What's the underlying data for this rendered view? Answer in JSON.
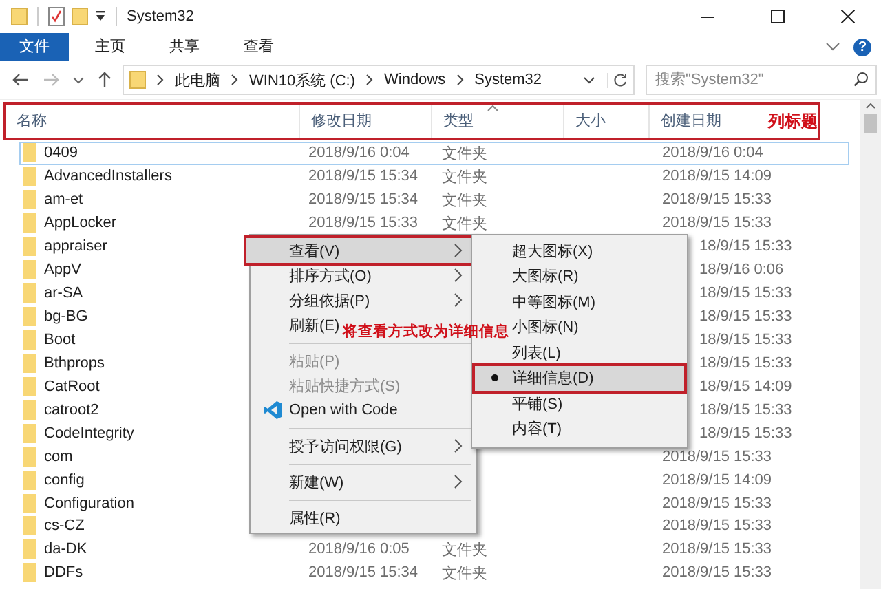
{
  "window": {
    "title": "System32"
  },
  "ribbon": {
    "tabs": [
      {
        "label": "文件",
        "selected": true
      },
      {
        "label": "主页",
        "selected": false
      },
      {
        "label": "共享",
        "selected": false
      },
      {
        "label": "查看",
        "selected": false
      }
    ],
    "help": "?"
  },
  "address": {
    "path": [
      "此电脑",
      "WIN10系统 (C:)",
      "Windows",
      "System32"
    ],
    "search": {
      "placeholder": "搜索\"System32\""
    }
  },
  "header": {
    "outlined": true,
    "annotation": "列标题",
    "columns": [
      {
        "label": "名称",
        "sorted": false
      },
      {
        "label": "修改日期",
        "sorted": false
      },
      {
        "label": "类型",
        "sorted": true
      },
      {
        "label": "大小",
        "sorted": false
      },
      {
        "label": "创建日期",
        "sorted": false
      }
    ]
  },
  "rows": [
    {
      "name": "0409",
      "modified": "2018/9/16 0:04",
      "type": "文件夹",
      "created": "2018/9/16 0:04",
      "covered": false,
      "focused": true
    },
    {
      "name": "AdvancedInstallers",
      "modified": "2018/9/15 15:34",
      "type": "文件夹",
      "created": "2018/9/15 14:09",
      "covered": false,
      "focused": false
    },
    {
      "name": "am-et",
      "modified": "2018/9/15 15:34",
      "type": "文件夹",
      "created": "2018/9/15 15:33",
      "covered": false,
      "focused": false
    },
    {
      "name": "AppLocker",
      "modified": "2018/9/15 15:33",
      "type": "文件夹",
      "created": "2018/9/15 15:33",
      "covered": false,
      "focused": false
    },
    {
      "name": "appraiser",
      "created": "18/9/15 15:33",
      "covered": true,
      "focused": false
    },
    {
      "name": "AppV",
      "created": "18/9/16 0:06",
      "covered": true,
      "focused": false
    },
    {
      "name": "ar-SA",
      "created": "18/9/15 15:33",
      "covered": true,
      "focused": false
    },
    {
      "name": "bg-BG",
      "created": "18/9/15 15:33",
      "covered": true,
      "focused": false
    },
    {
      "name": "Boot",
      "created": "18/9/15 15:33",
      "covered": true,
      "focused": false
    },
    {
      "name": "Bthprops",
      "created": "18/9/15 15:33",
      "covered": true,
      "focused": false
    },
    {
      "name": "CatRoot",
      "created": "18/9/15 14:09",
      "covered": true,
      "focused": false
    },
    {
      "name": "catroot2",
      "created": "18/9/15 15:33",
      "covered": true,
      "focused": false
    },
    {
      "name": "CodeIntegrity",
      "created": "18/9/15 15:33",
      "covered": true,
      "focused": false
    },
    {
      "name": "com",
      "created": "2018/9/15 15:33",
      "covered": false,
      "focused": false
    },
    {
      "name": "config",
      "created": "2018/9/15 14:09",
      "covered": false,
      "focused": false
    },
    {
      "name": "Configuration",
      "created": "2018/9/15 15:33",
      "covered": false,
      "focused": false
    },
    {
      "name": "cs-CZ",
      "created": "2018/9/15 15:33",
      "covered": false,
      "focused": false
    },
    {
      "name": "da-DK",
      "modified": "2018/9/16 0:05",
      "type": "文件夹",
      "created": "2018/9/15 15:33",
      "covered": false,
      "focused": false
    },
    {
      "name": "DDFs",
      "modified": "2018/9/15 15:34",
      "type": "文件夹",
      "created": "2018/9/15 15:33",
      "covered": false,
      "focused": false
    }
  ],
  "context_menu": {
    "items": [
      {
        "kind": "submenu",
        "label": "查看(V)",
        "disabled": false,
        "highlighted": true
      },
      {
        "kind": "submenu",
        "label": "排序方式(O)",
        "disabled": false,
        "highlighted": false
      },
      {
        "kind": "submenu",
        "label": "分组依据(P)",
        "disabled": false,
        "highlighted": false
      },
      {
        "kind": "item",
        "label": "刷新(E)",
        "disabled": false,
        "highlighted": false
      },
      {
        "kind": "separator"
      },
      {
        "kind": "item",
        "label": "粘贴(P)",
        "disabled": true,
        "highlighted": false
      },
      {
        "kind": "item",
        "label": "粘贴快捷方式(S)",
        "disabled": true,
        "highlighted": false
      },
      {
        "kind": "app",
        "label": "Open with Code",
        "disabled": false,
        "highlighted": false
      },
      {
        "kind": "separator"
      },
      {
        "kind": "submenu",
        "label": "授予访问权限(G)",
        "disabled": false,
        "highlighted": false
      },
      {
        "kind": "separator"
      },
      {
        "kind": "submenu",
        "label": "新建(W)",
        "disabled": false,
        "highlighted": false
      },
      {
        "kind": "separator"
      },
      {
        "kind": "item",
        "label": "属性(R)",
        "disabled": false,
        "highlighted": false
      }
    ]
  },
  "submenu": {
    "items": [
      {
        "label": "超大图标(X)",
        "selected": false
      },
      {
        "label": "大图标(R)",
        "selected": false
      },
      {
        "label": "中等图标(M)",
        "selected": false
      },
      {
        "label": "小图标(N)",
        "selected": false
      },
      {
        "label": "列表(L)",
        "selected": false
      },
      {
        "label": "详细信息(D)",
        "selected": true
      },
      {
        "label": "平铺(S)",
        "selected": false
      },
      {
        "label": "内容(T)",
        "selected": false
      }
    ]
  },
  "callout": "将查看方式改为详细信息"
}
